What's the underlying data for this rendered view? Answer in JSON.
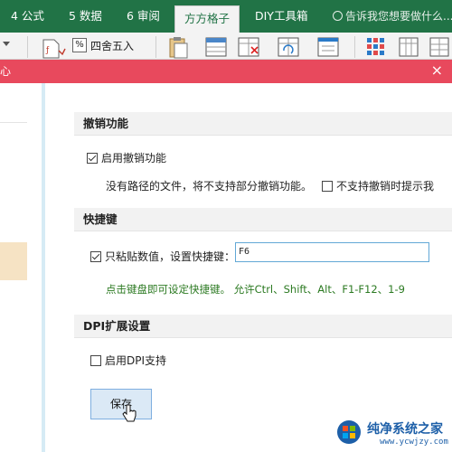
{
  "ribbon": {
    "tabs": [
      {
        "label": "4 公式"
      },
      {
        "label": "5 数据"
      },
      {
        "label": "6 审阅"
      },
      {
        "label": "方方格子"
      },
      {
        "label": "DIY工具箱"
      }
    ],
    "active_tab": "方方格子",
    "tell_me_placeholder": "告诉我您想要做什么...",
    "round_label": "四舍五入",
    "round_icon_glyph": "%",
    "accent_color": "#217346"
  },
  "dialog": {
    "title_fragment": "心",
    "close_glyph": "×",
    "titlebar_color": "#e8495d",
    "sections": {
      "undo": {
        "header": "撤销功能",
        "enable_label": "启用撤销功能",
        "enable_checked": true,
        "note": "没有路径的文件，将不支持部分撤销功能。",
        "no_prompt_label": "不支持撤销时提示我",
        "no_prompt_checked": false
      },
      "hotkey": {
        "header": "快捷键",
        "paste_values_label": "只粘贴数值，设置快捷键：",
        "paste_values_checked": true,
        "hotkey_value": "F6",
        "hint": "点击键盘即可设定快捷键。  允许Ctrl、Shift、Alt、F1-F12、1-9"
      },
      "dpi": {
        "header": "DPI扩展设置",
        "enable_label": "启用DPI支持",
        "enable_checked": false
      }
    },
    "save_label": "保存",
    "hint_color": "#2c7a22"
  },
  "watermark": {
    "title": "纯净系统之家",
    "url": "www.ycwjzy.com"
  }
}
